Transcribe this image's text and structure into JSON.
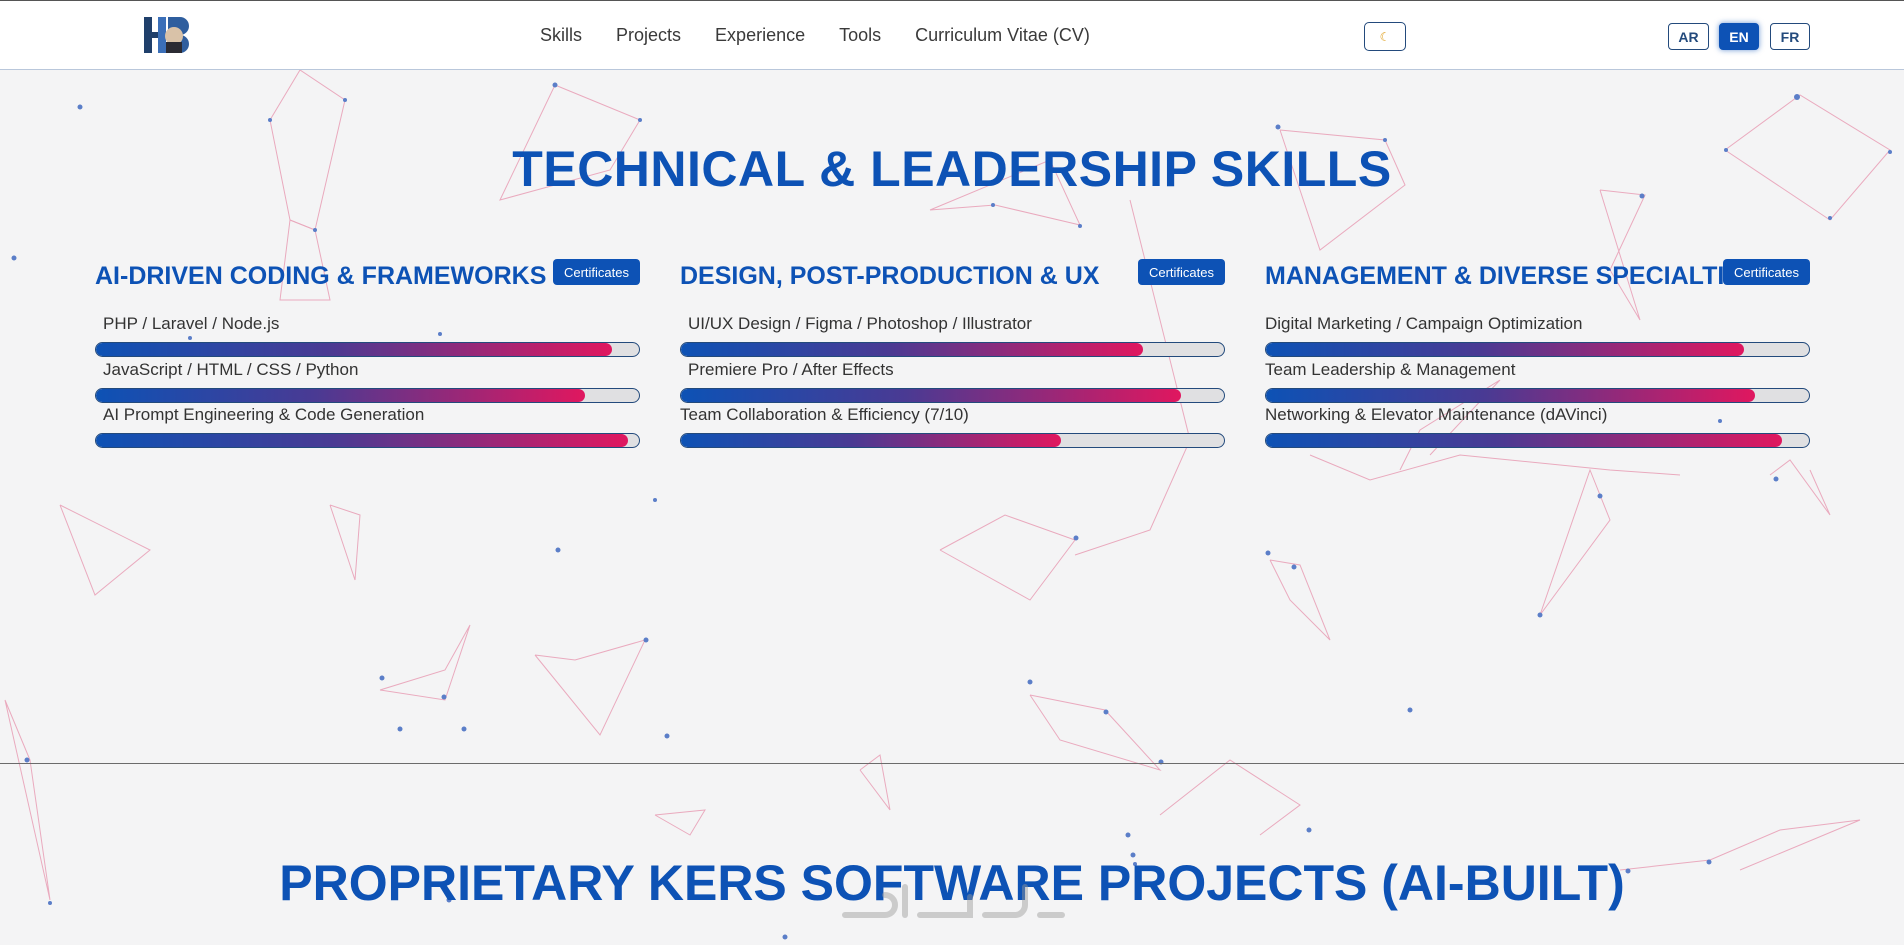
{
  "nav": {
    "logo_text": "HB",
    "items": [
      "Skills",
      "Projects",
      "Experience",
      "Tools",
      "Curriculum Vitae (CV)"
    ],
    "theme_toggle_icon": "moon-icon",
    "languages": [
      {
        "code": "AR",
        "active": false
      },
      {
        "code": "EN",
        "active": true
      },
      {
        "code": "FR",
        "active": false
      }
    ]
  },
  "skills_section": {
    "title": "TECHNICAL & LEADERSHIP SKILLS",
    "cards": [
      {
        "title": "AI-DRIVEN CODING & FRAMEWORKS",
        "certificates_label": "Certificates",
        "skills": [
          {
            "label": "PHP /  Laravel /  Node.js",
            "level": 0.95
          },
          {
            "label": "JavaScript /  HTML /  CSS /  Python",
            "level": 0.9
          },
          {
            "label": "AI Prompt Engineering & Code Generation",
            "level": 0.98
          }
        ]
      },
      {
        "title": "DESIGN, POST-PRODUCTION & UX",
        "certificates_label": "Certificates",
        "skills": [
          {
            "label": "UI/UX Design / Figma / Photoshop / Illustrator",
            "level": 0.85
          },
          {
            "label": "Premiere Pro / After Effects",
            "level": 0.92
          },
          {
            "label": "Team Collaboration & Efficiency (7/10)",
            "level": 0.7
          }
        ]
      },
      {
        "title": "MANAGEMENT & DIVERSE SPECIALTIES",
        "certificates_label": "Certificates",
        "skills": [
          {
            "label": "Digital Marketing / Campaign Optimization",
            "level": 0.88
          },
          {
            "label": "Team Leadership & Management",
            "level": 0.9
          },
          {
            "label": "Networking & Elevator Maintenance (dAVinci)",
            "level": 0.95
          }
        ]
      }
    ]
  },
  "projects_section": {
    "title": "PROPRIETARY KERS SOFTWARE PROJECTS (AI-BUILT)"
  },
  "colors": {
    "primary": "#0d52b5",
    "accent": "#e0175f",
    "network_line": "#e58aa6",
    "network_node": "#5b7ec8"
  }
}
